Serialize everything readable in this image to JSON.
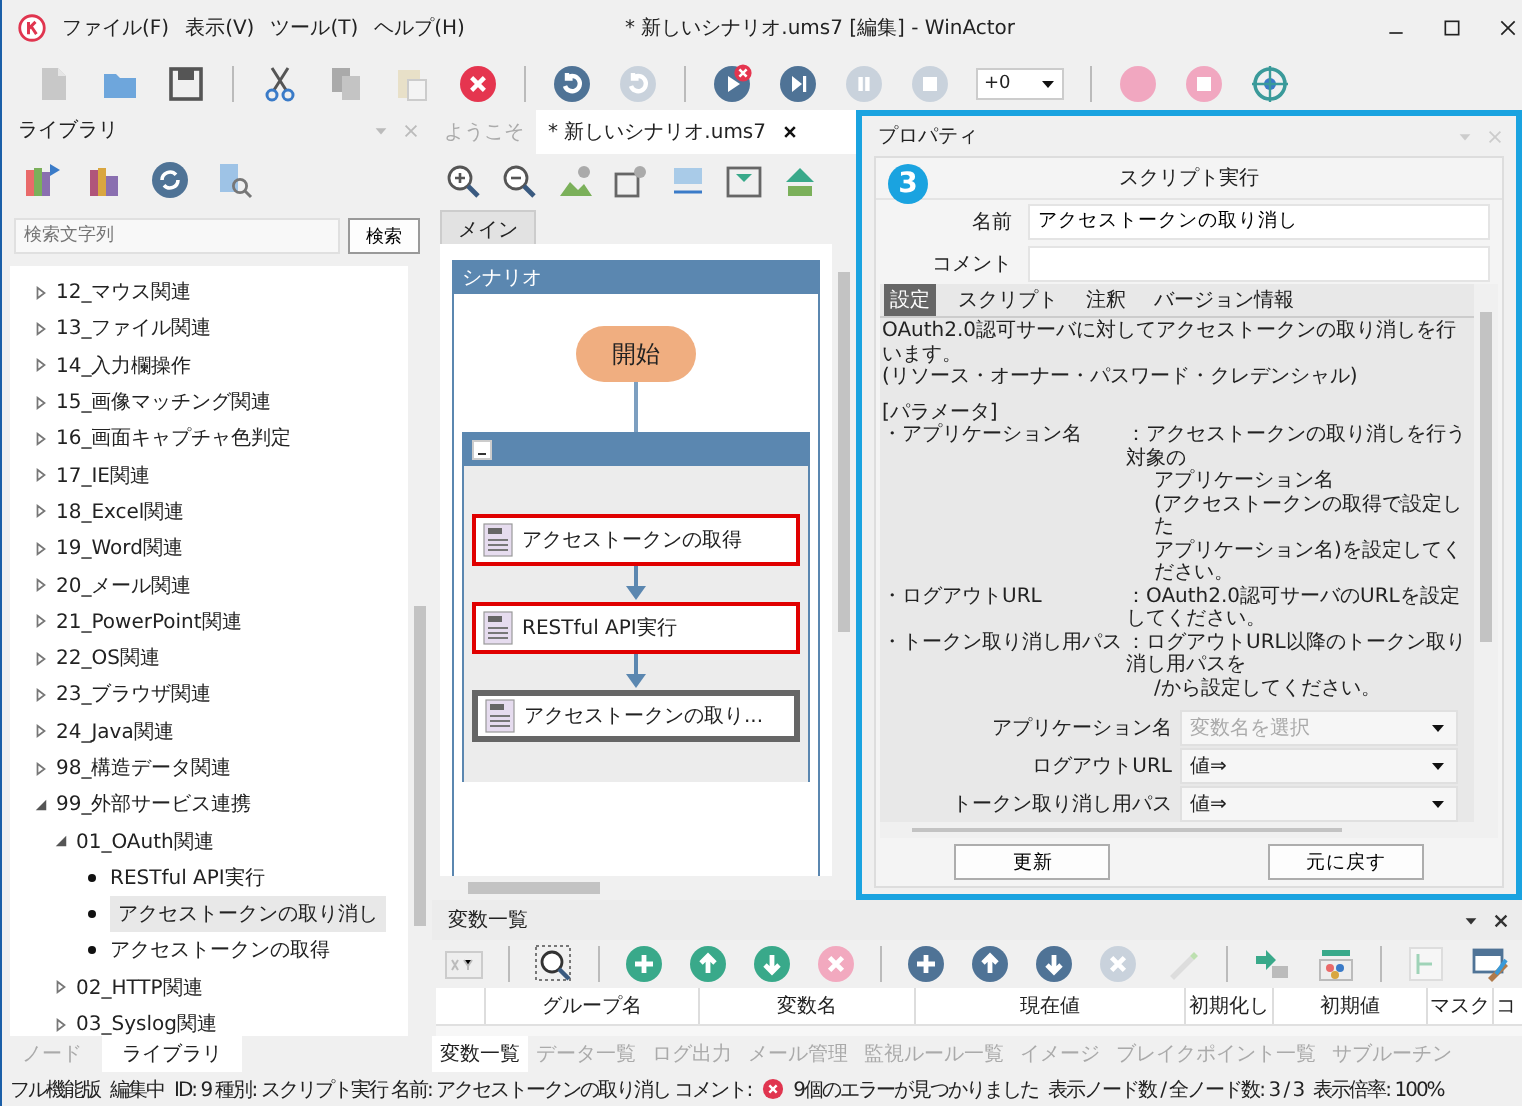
{
  "window": {
    "title": "* 新しいシナリオ.ums7 [編集] - WinActor"
  },
  "menu": [
    "ファイル(F)",
    "表示(V)",
    "ツール(T)",
    "ヘルプ(H)"
  ],
  "toolbar": {
    "speed": "+0"
  },
  "library": {
    "title": "ライブラリ",
    "search_placeholder": "検索文字列",
    "search_button": "検索",
    "tree": [
      {
        "label": "12_マウス関連",
        "expanded": false,
        "selected": false
      },
      {
        "label": "13_ファイル関連",
        "expanded": false,
        "selected": false
      },
      {
        "label": "14_入力欄操作",
        "expanded": false,
        "selected": false
      },
      {
        "label": "15_画像マッチング関連",
        "expanded": false,
        "selected": false
      },
      {
        "label": "16_画面キャプチャ色判定",
        "expanded": false,
        "selected": false
      },
      {
        "label": "17_IE関連",
        "expanded": false,
        "selected": false
      },
      {
        "label": "18_Excel関連",
        "expanded": false,
        "selected": false
      },
      {
        "label": "19_Word関連",
        "expanded": false,
        "selected": false
      },
      {
        "label": "20_メール関連",
        "expanded": false,
        "selected": false
      },
      {
        "label": "21_PowerPoint関連",
        "expanded": false,
        "selected": false
      },
      {
        "label": "22_OS関連",
        "expanded": false,
        "selected": false
      },
      {
        "label": "23_ブラウザ関連",
        "expanded": false,
        "selected": false
      },
      {
        "label": "24_Java関連",
        "expanded": false,
        "selected": false
      },
      {
        "label": "98_構造データ関連",
        "expanded": false,
        "selected": false
      },
      {
        "label": "99_外部サービス連携",
        "expanded": true,
        "selected": false,
        "children": [
          {
            "label": "01_OAuth関連",
            "expanded": true,
            "selected": false,
            "children": [
              {
                "label": "RESTful API実行",
                "selected": false
              },
              {
                "label": "アクセストークンの取り消し",
                "selected": true
              },
              {
                "label": "アクセストークンの取得",
                "selected": false
              }
            ]
          },
          {
            "label": "02_HTTP関連",
            "expanded": false,
            "selected": false
          },
          {
            "label": "03_Syslog関連",
            "expanded": false,
            "selected": false
          }
        ]
      }
    ],
    "tabs": [
      {
        "label": "ノード",
        "selected": false
      },
      {
        "label": "ライブラリ",
        "selected": true
      }
    ]
  },
  "editor": {
    "tabs": [
      {
        "label": "ようこそ",
        "selected": false
      },
      {
        "label": "* 新しいシナリオ.ums7",
        "selected": true
      }
    ],
    "sheets": [
      {
        "label": "メイン",
        "selected": true
      }
    ],
    "scenario_title": "シナリオ",
    "start": "開始",
    "nodes": [
      {
        "label": "アクセストークンの取得",
        "error": true,
        "selected": false
      },
      {
        "label": "RESTful API実行",
        "error": true,
        "selected": false
      },
      {
        "label": "アクセストークンの取り...",
        "error": false,
        "selected": true
      }
    ]
  },
  "properties": {
    "title": "プロパティ",
    "step": "3",
    "heading": "スクリプト実行",
    "name_label": "名前",
    "name_value": "アクセストークンの取り消し",
    "comment_label": "コメント",
    "tabs": [
      {
        "label": "設定",
        "selected": true
      },
      {
        "label": "スクリプト",
        "selected": false
      },
      {
        "label": "注釈",
        "selected": false
      },
      {
        "label": "バージョン情報",
        "selected": false
      }
    ],
    "intro": [
      "OAuth2.0認可サーバに対してアクセストークンの取り消しを行います。",
      "(リソース・オーナー・パスワード・クレデンシャル)"
    ],
    "section": "[パラメータ]",
    "param_notes": [
      {
        "name": "・アプリケーション名",
        "lines": [
          "：アクセストークンの取り消しを行う対象の",
          "アプリケーション名",
          "(アクセストークンの取得で設定した",
          "アプリケーション名)を設定してください。"
        ]
      },
      {
        "name": "・ログアウトURL",
        "lines": [
          "：OAuth2.0認可サーバのURLを設定してください。"
        ]
      },
      {
        "name": "・トークン取り消し用パス",
        "lines": [
          "：ログアウトURL以降のトークン取り消し用パスを",
          "/から設定してください。"
        ]
      }
    ],
    "params": [
      {
        "label": "アプリケーション名",
        "placeholder": "変数名を選択"
      },
      {
        "label": "ログアウトURL",
        "value": "値⇒"
      },
      {
        "label": "トークン取り消し用パス",
        "value": "値⇒"
      }
    ],
    "buttons": [
      "更新",
      "元に戻す"
    ]
  },
  "variables": {
    "title": "変数一覧",
    "columns": [
      "グループ名",
      "変数名",
      "現在値",
      "初期化し",
      "初期値",
      "マスク",
      "コ"
    ],
    "tabs": [
      {
        "label": "変数一覧",
        "selected": true
      },
      {
        "label": "データ一覧",
        "selected": false
      },
      {
        "label": "ログ出力",
        "selected": false
      },
      {
        "label": "メール管理",
        "selected": false
      },
      {
        "label": "監視ルール一覧",
        "selected": false
      },
      {
        "label": "イメージ",
        "selected": false
      },
      {
        "label": "ブレイクポイント一覧",
        "selected": false
      },
      {
        "label": "サブルーチン",
        "selected": false
      }
    ]
  },
  "status_bar": {
    "edition": "フル機能版",
    "mode": "編集中",
    "info": "ID: 9 種別: スクリプト実行 名前: アクセストークンの取り消し コメント:",
    "error": "9個のエラーが見つかりました",
    "nodes": "表示ノード数 / 全ノード数: 3 / 3",
    "zoom": "表示倍率: 100%"
  }
}
